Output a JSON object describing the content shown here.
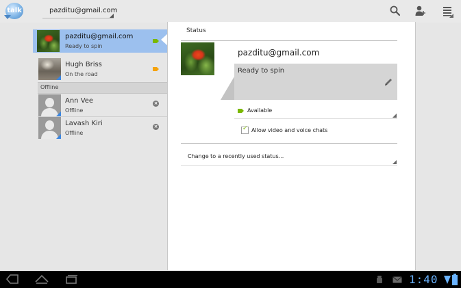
{
  "app": {
    "logo_text": "talk"
  },
  "account": {
    "selected": "pazditu@gmail.com"
  },
  "toolbar": {
    "icons": [
      "search-icon",
      "add-friend-icon",
      "menu-icon"
    ]
  },
  "contacts": [
    {
      "name": "pazditu@gmail.com",
      "status": "Ready to spin",
      "presence_icon": "video-available-icon",
      "presence_color": "#7ab800"
    },
    {
      "name": "Hugh Briss",
      "status": "On the road",
      "presence_icon": "video-busy-icon",
      "presence_color": "#f5a30c"
    }
  ],
  "offline_section": {
    "label": "Offline",
    "contacts": [
      {
        "name": "Ann Vee",
        "status": "Offline"
      },
      {
        "name": "Lavash Kiri",
        "status": "Offline"
      }
    ]
  },
  "status_panel": {
    "title": "Status",
    "email": "pazditu@gmail.com",
    "status_message": "Ready to spin",
    "availability": "Available",
    "availability_color": "#7ab800",
    "allow_video_label": "Allow video and voice chats",
    "allow_video_checked": true,
    "recent_status_label": "Change to a recently used status..."
  },
  "system_bar": {
    "time": "1:40"
  },
  "colors": {
    "selected_row": "#9cc0ee",
    "accent_blue": "#3b86e0"
  }
}
